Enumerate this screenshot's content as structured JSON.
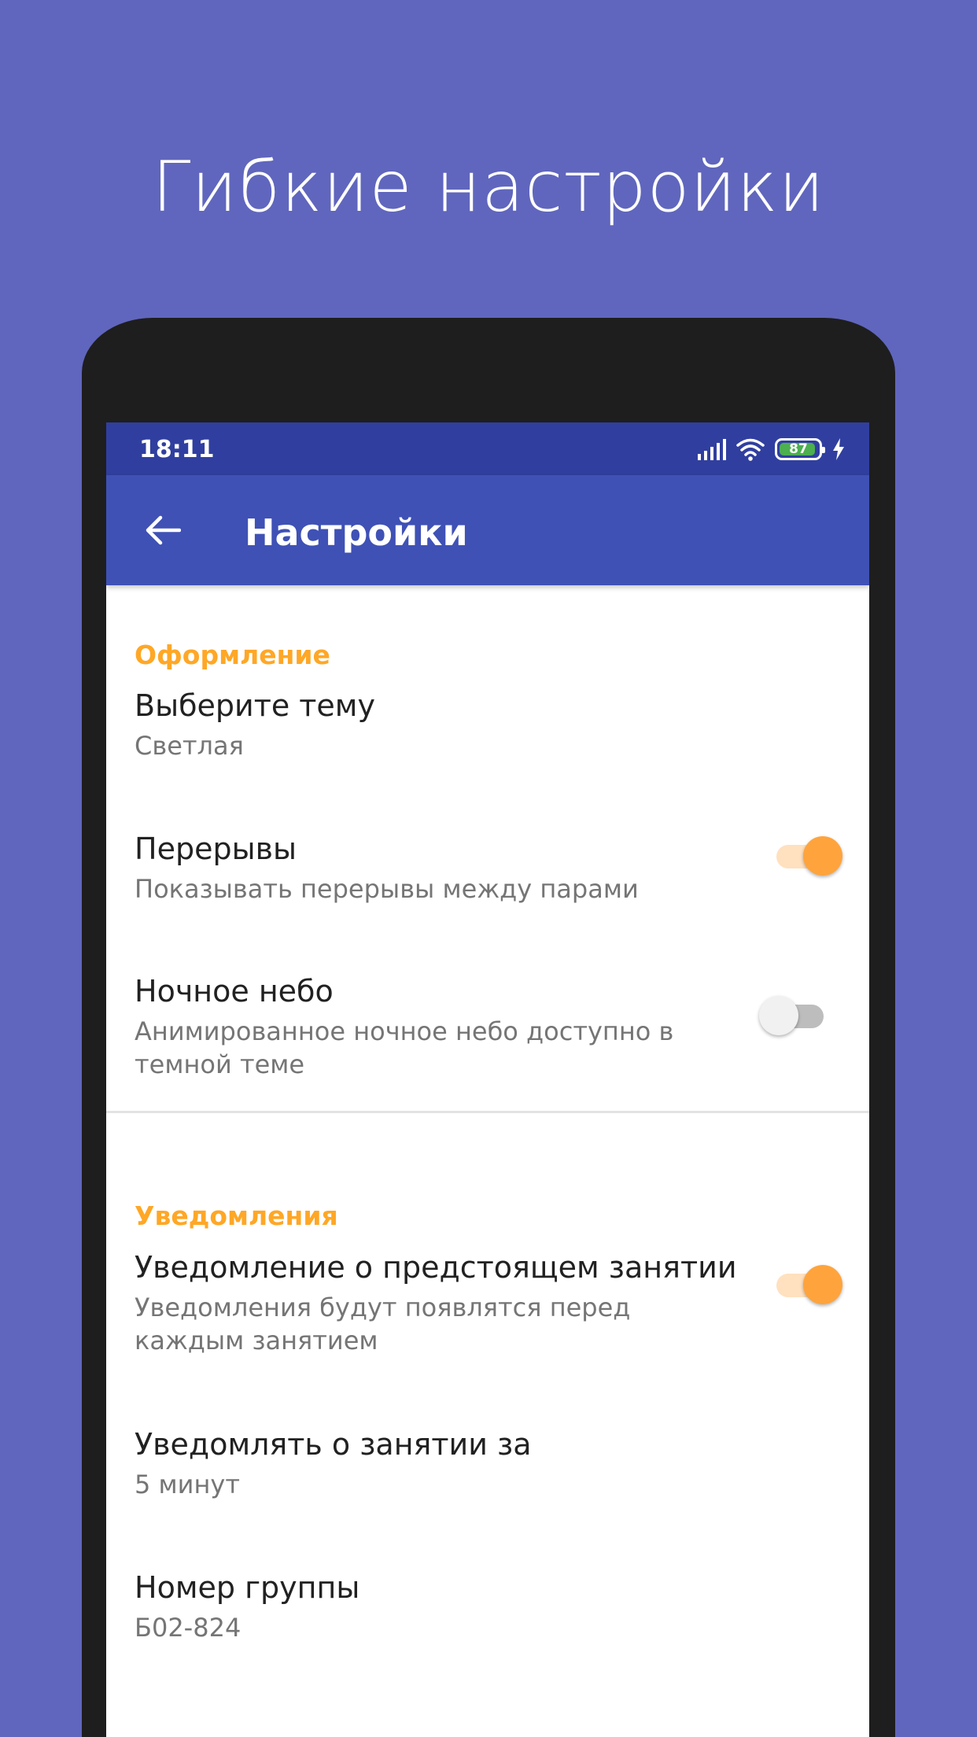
{
  "headline": "Гибкие настройки",
  "status_bar": {
    "time": "18:11",
    "battery_level": "87",
    "icons": [
      "signal-icon",
      "wifi-icon",
      "battery-icon",
      "charging-icon"
    ]
  },
  "app_bar": {
    "back_icon": "arrow-back-icon",
    "title": "Настройки"
  },
  "sections": {
    "appearance": {
      "header": "Оформление",
      "theme": {
        "title": "Выберите тему",
        "summary": "Светлая"
      },
      "breaks": {
        "title": "Перерывы",
        "summary": "Показывать перерывы между парами",
        "enabled": true
      },
      "night_sky": {
        "title": "Ночное небо",
        "summary": "Анимированное ночное небо доступно в темной теме",
        "enabled": false
      }
    },
    "notifications": {
      "header": "Уведомления",
      "upcoming": {
        "title": "Уведомление о предстоящем занятии",
        "summary": "Уведомления будут появлятся перед каждым занятием",
        "enabled": true
      },
      "notify_before": {
        "title": "Уведомлять о занятии за",
        "summary": "5 минут"
      },
      "group": {
        "title": "Номер группы",
        "summary": "Б02-824"
      }
    }
  },
  "colors": {
    "background": "#6066bd",
    "status_bar": "#303f9f",
    "app_bar": "#3f51b5",
    "accent": "#ffa726",
    "switch_on": "#ffa43c",
    "battery": "#4caf50"
  }
}
